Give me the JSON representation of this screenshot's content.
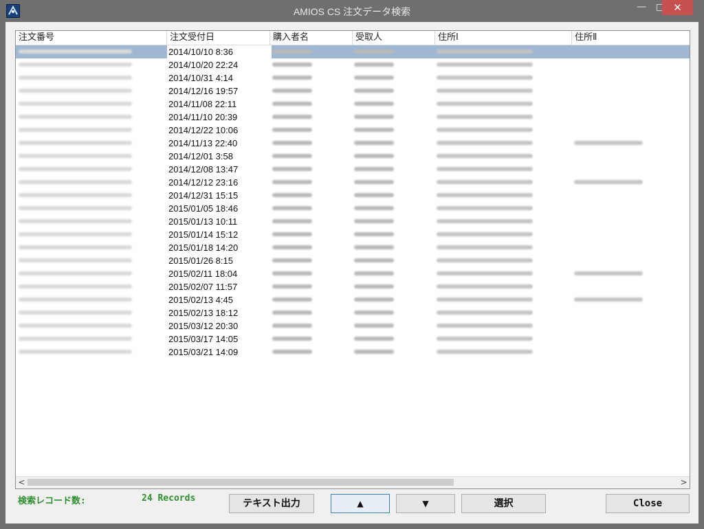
{
  "window": {
    "title": "AMIOS CS 注文データ検索",
    "minimize_label": "—",
    "close_label": "✕"
  },
  "grid": {
    "columns": [
      "注文番号",
      "注文受付日",
      "購入者名",
      "受取人",
      "住所Ⅰ",
      "住所Ⅱ"
    ],
    "rows": [
      {
        "date": "2014/10/10 8:36",
        "selected": true,
        "addr2": false
      },
      {
        "date": "2014/10/20 22:24",
        "addr2": false
      },
      {
        "date": "2014/10/31 4:14",
        "addr2": false
      },
      {
        "date": "2014/12/16 19:57",
        "addr2": false
      },
      {
        "date": "2014/11/08 22:11",
        "addr2": false
      },
      {
        "date": "2014/11/10 20:39",
        "addr2": false
      },
      {
        "date": "2014/12/22 10:06",
        "addr2": false
      },
      {
        "date": "2014/11/13 22:40",
        "addr2": true
      },
      {
        "date": "2014/12/01 3:58",
        "addr2": false
      },
      {
        "date": "2014/12/08 13:47",
        "addr2": false
      },
      {
        "date": "2014/12/12 23:16",
        "addr2": true
      },
      {
        "date": "2014/12/31 15:15",
        "addr2": false
      },
      {
        "date": "2015/01/05 18:46",
        "addr2": false
      },
      {
        "date": "2015/01/13 10:11",
        "addr2": false
      },
      {
        "date": "2015/01/14 15:12",
        "addr2": false
      },
      {
        "date": "2015/01/18 14:20",
        "addr2": false
      },
      {
        "date": "2015/01/26 8:15",
        "addr2": false
      },
      {
        "date": "2015/02/11 18:04",
        "addr2": true
      },
      {
        "date": "2015/02/07 11:57",
        "addr2": false
      },
      {
        "date": "2015/02/13 4:45",
        "addr2": true
      },
      {
        "date": "2015/02/13 18:12",
        "addr2": false
      },
      {
        "date": "2015/03/12 20:30",
        "addr2": false
      },
      {
        "date": "2015/03/17 14:05",
        "addr2": false
      },
      {
        "date": "2015/03/21 14:09",
        "addr2": false
      }
    ]
  },
  "scrollbar": {
    "left": "<",
    "right": ">"
  },
  "status": {
    "label": "検索レコード数:",
    "count": "24  Records"
  },
  "buttons": {
    "text_export": "テキスト出力",
    "up": "▲",
    "down": "▼",
    "select": "選択",
    "close": "Close"
  },
  "colors": {
    "selection": "#9fb7d2",
    "status_text": "#2f8f2f",
    "close_button": "#c75050"
  }
}
